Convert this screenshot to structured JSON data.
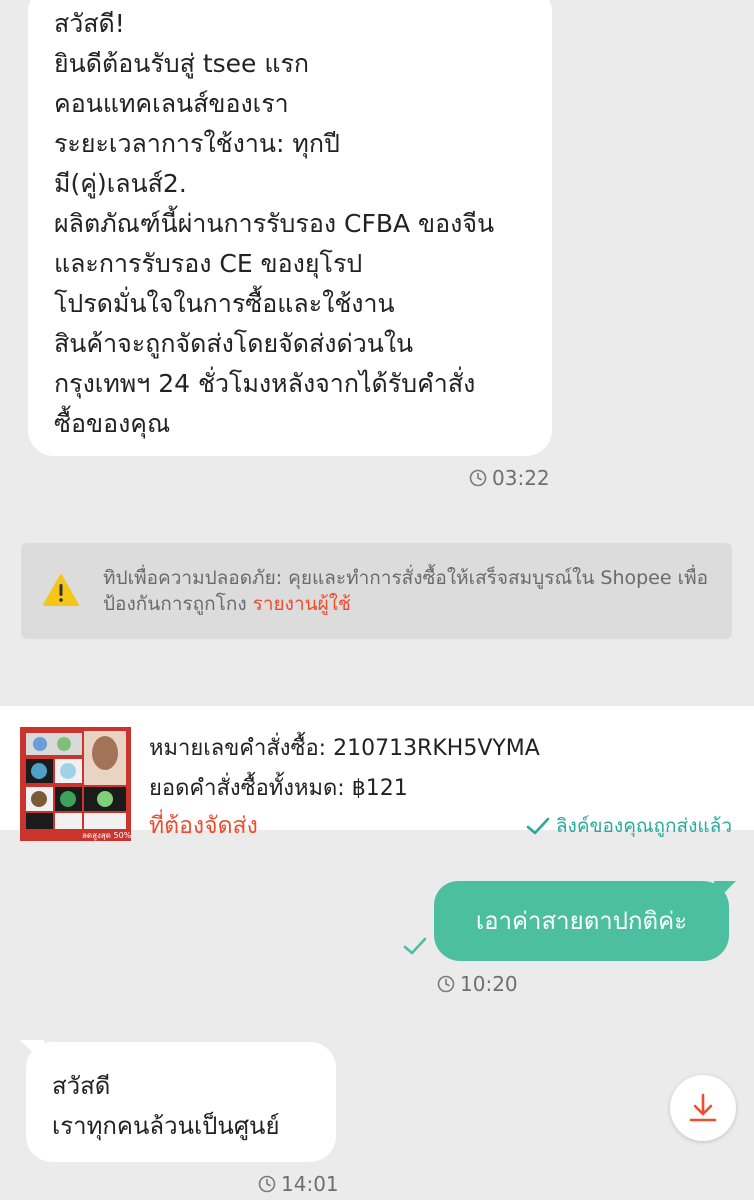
{
  "colors": {
    "background": "#ebebeb",
    "accent": "#ee4d2d",
    "outgoing_bubble": "#4cbfa0",
    "success": "#26aa99",
    "warning": "#f5c518"
  },
  "messages": [
    {
      "direction": "incoming",
      "lines": [
        "สวัสดี!",
        "ยินดีต้อนรับสู่ tsee แรก",
        "คอนแทคเลนส์ของเรา",
        "ระยะเวลาการใช้งาน: ทุกปี",
        "มี(คู่)เลนส์2.",
        "ผลิตภัณฑ์นี้ผ่านการรับรอง CFBA ของจีน",
        "และการรับรอง CE ของยุโรป",
        "โปรดมั่นใจในการซื้อและใช้งาน",
        "สินค้าจะถูกจัดส่งโดยจัดส่งด่วนใน",
        "กรุงเทพฯ 24 ชั่วโมงหลังจากได้รับคำสั่ง",
        "ซื้อของคุณ"
      ],
      "time": "03:22"
    },
    {
      "direction": "outgoing",
      "text": "เอาค่าสายตาปกติค่ะ",
      "time": "10:20",
      "status_icon": "check-icon"
    },
    {
      "direction": "incoming",
      "lines": [
        "สวัสดี",
        "เราทุกคนล้วนเป็นศูนย์"
      ],
      "time": "14:01"
    }
  ],
  "safety_tip": {
    "icon": "warning-icon",
    "text": "ทิปเพื่อความปลอดภัย: คุยและทำการสั่งซื้อให้เสร็จสมบูรณ์ใน Shopee เพื่อป้องกันการถูกโกง",
    "link": "รายงานผู้ใช้"
  },
  "order": {
    "number_label": "หมายเลขคำสั่งซื้อ: 210713RKH5VYMA",
    "total_label": "ยอดคำสั่งซื้อทั้งหมด: ฿121",
    "status": "ที่ต้องจัดส่ง",
    "link_status": "ลิงค์ของคุณถูกส่งแล้ว",
    "thumbnail_badge": "ลดสูงสุด 50%"
  },
  "download_button": {
    "icon": "download-icon"
  }
}
